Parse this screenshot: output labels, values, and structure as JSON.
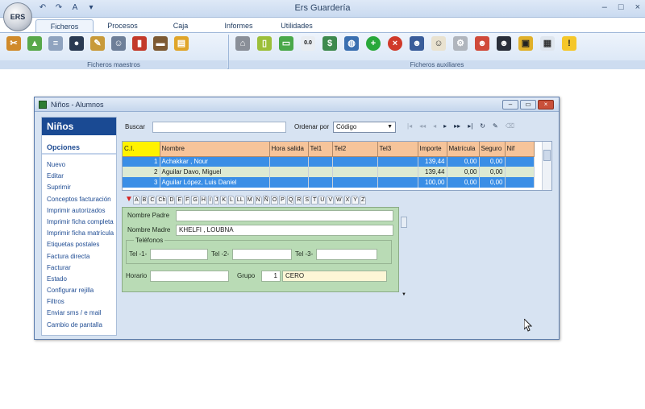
{
  "app": {
    "title": "Ers Guardería",
    "orb": "ERS",
    "qat": [
      "↶",
      "↷",
      "A",
      "▾"
    ],
    "window_controls": [
      "–",
      "□",
      "×"
    ]
  },
  "ribbon": {
    "tabs": [
      "Ficheros",
      "Procesos",
      "Caja",
      "Informes",
      "Utilidades"
    ],
    "active_tab": "Ficheros",
    "groups": [
      {
        "label": "Ficheros maestros",
        "icons": [
          "tools-icon",
          "shapes-icon",
          "document-icon",
          "penguin-icon",
          "pencils-icon",
          "teacher-icon",
          "red-book-icon",
          "books-icon",
          "notebook-icon"
        ]
      },
      {
        "label": "Ficheros auxiliares",
        "icons": [
          "bank-icon",
          "bottle-icon",
          "battery-icon",
          "counter-icon",
          "money-icon",
          "globe-icon",
          "add-icon",
          "delete-icon",
          "user-icon",
          "chef-icon",
          "tools-icon",
          "sick-icon",
          "police-icon",
          "bus-icon",
          "calculator-icon",
          "warning-icon"
        ]
      }
    ],
    "colors": {
      "ribbon_bg": "#e3ecf8",
      "accent": "#2f5f9f"
    }
  },
  "window": {
    "title": "Niños - Alumnos",
    "buttons": [
      "–",
      "▭",
      "×"
    ],
    "sidebar": {
      "header": "Niños",
      "section": "Opciones",
      "items": [
        "Nuevo",
        "Editar",
        "Suprimir",
        "Conceptos facturación",
        "Imprimir autorizados",
        "Imprimir ficha completa",
        "Imprimir ficha matrícula",
        "Etiquetas postales",
        "Factura directa",
        "Facturar",
        "Estado",
        "Configurar rejilla",
        "Filtros",
        "Enviar sms / e mail",
        "Cambio de pantalla"
      ]
    },
    "toolbar": {
      "search_label": "Buscar",
      "search_value": "",
      "order_label": "Ordenar por",
      "order_value": "Código",
      "nav": [
        "|◂",
        "◂◂",
        "◂",
        "▸",
        "▸▸",
        "▸|",
        "↻",
        "✎",
        "⌫"
      ]
    },
    "grid": {
      "columns": [
        "C.I.",
        "Nombre",
        "Hora salida",
        "Tel1",
        "Tel2",
        "Tel3",
        "Importe",
        "Matrícula",
        "Seguro",
        "Nif"
      ],
      "rows": [
        {
          "ci": "1",
          "nombre": "Achakkar , Nour",
          "hora": "",
          "tel1": "",
          "tel2": "",
          "tel3": "",
          "importe": "139,44",
          "matricula": "0,00",
          "seguro": "0,00",
          "nif": ""
        },
        {
          "ci": "2",
          "nombre": "Aguilar Davo, Miguel",
          "hora": "",
          "tel1": "",
          "tel2": "",
          "tel3": "",
          "importe": "139,44",
          "matricula": "0,00",
          "seguro": "0,00",
          "nif": ""
        },
        {
          "ci": "3",
          "nombre": "Aguilar López, Luis Daniel",
          "hora": "",
          "tel1": "",
          "tel2": "",
          "tel3": "",
          "importe": "100,00",
          "matricula": "0,00",
          "seguro": "0,00",
          "nif": ""
        }
      ]
    },
    "letters": [
      "A",
      "B",
      "C",
      "Ch",
      "D",
      "E",
      "F",
      "G",
      "H",
      "I",
      "J",
      "K",
      "L",
      "LL",
      "M",
      "N",
      "Ñ",
      "O",
      "P",
      "Q",
      "R",
      "S",
      "T",
      "U",
      "V",
      "W",
      "X",
      "Y",
      "Z"
    ],
    "detail": {
      "nombre_padre_label": "Nombre Padre",
      "nombre_padre": "",
      "nombre_madre_label": "Nombre Madre",
      "nombre_madre": "KHELFI , LOUBNA",
      "telefonos_label": "Teléfonos",
      "tel1_label": "Tel -1-",
      "tel1": "",
      "tel2_label": "Tel -2-",
      "tel2": "",
      "tel3_label": "Tel -3-",
      "tel3": "",
      "horario_label": "Horario",
      "horario": "",
      "grupo_label": "Grupo",
      "grupo_num": "1",
      "grupo_name": "CERO"
    }
  }
}
